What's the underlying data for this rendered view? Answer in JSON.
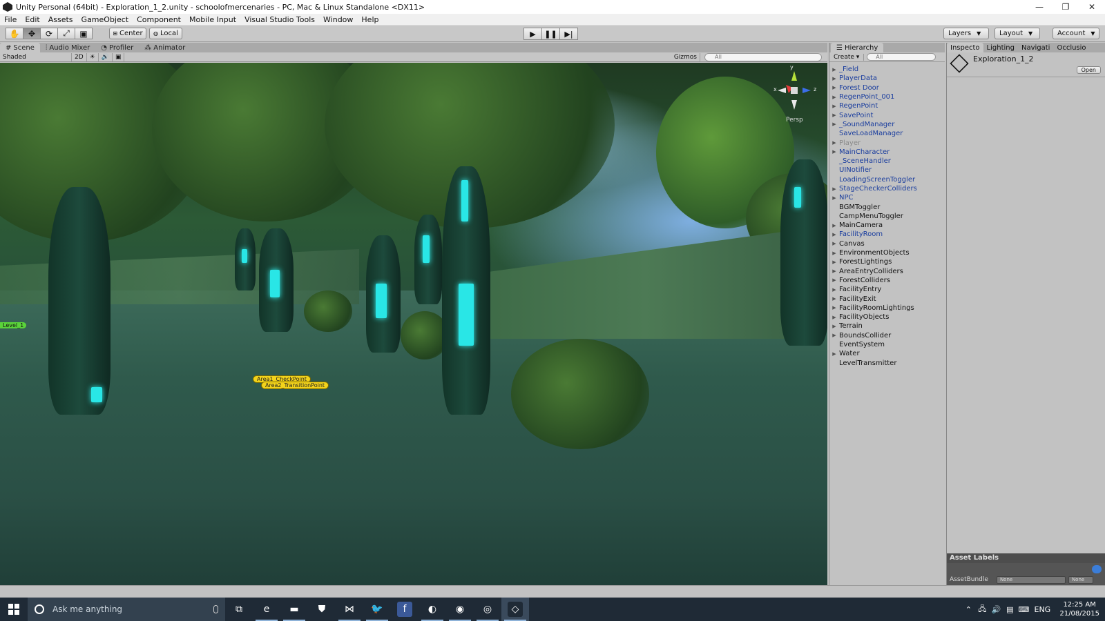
{
  "window": {
    "title": "Unity Personal (64bit) - Exploration_1_2.unity - schoolofmercenaries - PC, Mac & Linux Standalone <DX11>",
    "controls": [
      "—",
      "❐",
      "✕"
    ]
  },
  "menu": [
    "File",
    "Edit",
    "Assets",
    "GameObject",
    "Component",
    "Mobile Input",
    "Visual Studio Tools",
    "Window",
    "Help"
  ],
  "toolbar": {
    "pivot_label": "Center",
    "space_label": "Local",
    "layers_label": "Layers",
    "layout_label": "Layout",
    "account_label": "Account"
  },
  "scene_tabs": [
    "Scene",
    "Audio Mixer",
    "Profiler",
    "Animator"
  ],
  "scene_toolbar": {
    "shading": "Shaded",
    "mode_2d": "2D",
    "gizmos_label": "Gizmos",
    "search_placeholder": "All"
  },
  "viewport": {
    "labels": {
      "checkpoint": "Area1_CheckPoint",
      "transition": "Area2_TransitionPoint",
      "level": "Level_1"
    },
    "gizmo": {
      "x_axis": "x",
      "y_axis": "y",
      "z_axis": "z",
      "projection": "Persp"
    }
  },
  "hierarchy": {
    "tab": "Hierarchy",
    "create_label": "Create",
    "search_placeholder": "All",
    "items": [
      {
        "name": "_Field",
        "expand": true,
        "style": "prefab"
      },
      {
        "name": "PlayerData",
        "expand": true,
        "style": "prefab"
      },
      {
        "name": "Forest Door",
        "expand": true,
        "style": "prefab"
      },
      {
        "name": "RegenPoint_001",
        "expand": true,
        "style": "prefab"
      },
      {
        "name": "RegenPoint",
        "expand": true,
        "style": "prefab"
      },
      {
        "name": "SavePoint",
        "expand": true,
        "style": "prefab"
      },
      {
        "name": "_SoundManager",
        "expand": true,
        "style": "prefab"
      },
      {
        "name": "SaveLoadManager",
        "expand": false,
        "style": "prefab"
      },
      {
        "name": "Player",
        "expand": true,
        "style": "gray"
      },
      {
        "name": "MainCharacter",
        "expand": true,
        "style": "prefab"
      },
      {
        "name": "_SceneHandler",
        "expand": false,
        "style": "prefab"
      },
      {
        "name": "UINotifier",
        "expand": false,
        "style": "prefab"
      },
      {
        "name": "LoadingScreenToggler",
        "expand": false,
        "style": "prefab"
      },
      {
        "name": "StageCheckerColliders",
        "expand": true,
        "style": "prefab"
      },
      {
        "name": "NPC",
        "expand": true,
        "style": "prefab"
      },
      {
        "name": "BGMToggler",
        "expand": false,
        "style": "black"
      },
      {
        "name": "CampMenuToggler",
        "expand": false,
        "style": "black"
      },
      {
        "name": "MainCamera",
        "expand": true,
        "style": "black"
      },
      {
        "name": "FacilityRoom",
        "expand": true,
        "style": "prefab"
      },
      {
        "name": "Canvas",
        "expand": true,
        "style": "black"
      },
      {
        "name": "EnvironmentObjects",
        "expand": true,
        "style": "black"
      },
      {
        "name": "ForestLightings",
        "expand": true,
        "style": "black"
      },
      {
        "name": "AreaEntryColliders",
        "expand": true,
        "style": "black"
      },
      {
        "name": "ForestColliders",
        "expand": true,
        "style": "black"
      },
      {
        "name": "FacilityEntry",
        "expand": true,
        "style": "black"
      },
      {
        "name": "FacilityExit",
        "expand": true,
        "style": "black"
      },
      {
        "name": "FacilityRoomLightings",
        "expand": true,
        "style": "black"
      },
      {
        "name": "FacilityObjects",
        "expand": true,
        "style": "black"
      },
      {
        "name": "Terrain",
        "expand": true,
        "style": "black"
      },
      {
        "name": "BoundsCollider",
        "expand": true,
        "style": "black"
      },
      {
        "name": "EventSystem",
        "expand": false,
        "style": "black"
      },
      {
        "name": "Water",
        "expand": true,
        "style": "black"
      },
      {
        "name": "LevelTransmitter",
        "expand": false,
        "style": "black"
      }
    ]
  },
  "inspector": {
    "tabs": [
      "Inspecto",
      "Lighting",
      "Navigati",
      "Occlusio"
    ],
    "asset_name": "Exploration_1_2",
    "open_label": "Open",
    "asset_labels_title": "Asset Labels",
    "asset_bundle_label": "AssetBundle",
    "asset_bundle_value": "None",
    "asset_variant_value": "None"
  },
  "taskbar": {
    "search_placeholder": "Ask me anything",
    "apps": [
      {
        "name": "task-view",
        "glyph": "⧉",
        "color": "#1f2a36"
      },
      {
        "name": "edge",
        "glyph": "e",
        "color": "#1f2a36"
      },
      {
        "name": "file-explorer",
        "glyph": "▬",
        "color": "#1f2a36"
      },
      {
        "name": "store",
        "glyph": "⛊",
        "color": "#1f2a36"
      },
      {
        "name": "visual-studio",
        "glyph": "⋈",
        "color": "#1f2a36"
      },
      {
        "name": "twitter",
        "glyph": "🐦",
        "color": "#1f2a36"
      },
      {
        "name": "facebook",
        "glyph": "f",
        "color": "#3b5998"
      },
      {
        "name": "steam",
        "glyph": "◐",
        "color": "#1f2a36"
      },
      {
        "name": "spotify",
        "glyph": "◉",
        "color": "#1f2a36"
      },
      {
        "name": "chrome",
        "glyph": "◎",
        "color": "#1f2a36"
      },
      {
        "name": "unity",
        "glyph": "◇",
        "color": "#1f2a36"
      }
    ],
    "tray": {
      "language": "ENG",
      "time": "12:25 AM",
      "date": "21/08/2015"
    }
  },
  "colors": {
    "prefab_text": "#1a3d9e",
    "label_yellow": "#f3d31b",
    "level_green": "#5ad33a",
    "glow_cyan": "#29e6e6"
  }
}
